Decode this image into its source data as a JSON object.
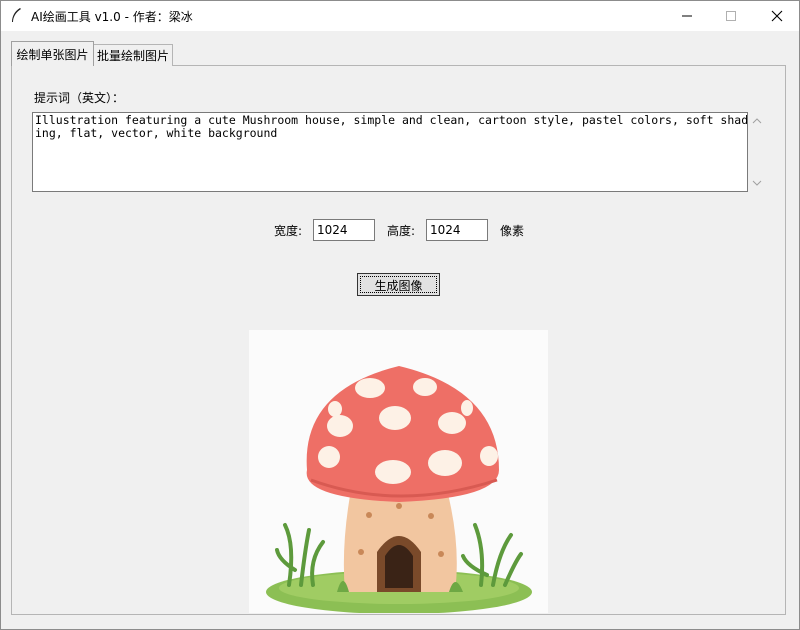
{
  "window": {
    "title": "AI绘画工具 v1.0 - 作者：梁冰",
    "icons": [
      "feather-icon",
      "minimize-icon",
      "maximize-icon",
      "close-icon"
    ]
  },
  "tabs": [
    {
      "label": "绘制单张图片",
      "active": true
    },
    {
      "label": "批量绘制图片",
      "active": false
    }
  ],
  "prompt": {
    "label": "提示词（英文）：",
    "value": "Illustration featuring a cute Mushroom house, simple and clean, cartoon style, pastel colors, soft shading, flat, vector, white background"
  },
  "size": {
    "width_label": "宽度:",
    "width_value": "1024",
    "height_label": "高度:",
    "height_value": "1024",
    "unit": "像素"
  },
  "generate_button": "生成图像",
  "image": {
    "subject": "mushroom-house",
    "colors": {
      "cap": "#ee6f66",
      "spots": "#fdf1e6",
      "stem": "#f2c6a0",
      "grass": "#8cbf54"
    }
  }
}
